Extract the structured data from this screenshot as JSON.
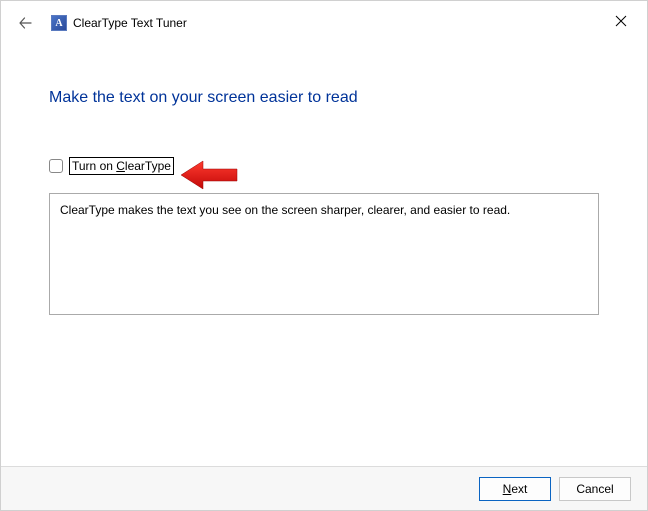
{
  "titlebar": {
    "title": "ClearType Text Tuner",
    "icon_letter": "A"
  },
  "heading": "Make the text on your screen easier to read",
  "checkbox": {
    "label": "Turn on ClearType",
    "checked": false
  },
  "description": "ClearType makes the text you see on the screen sharper, clearer, and easier to read.",
  "footer": {
    "next_label": "Next",
    "cancel_label": "Cancel"
  }
}
